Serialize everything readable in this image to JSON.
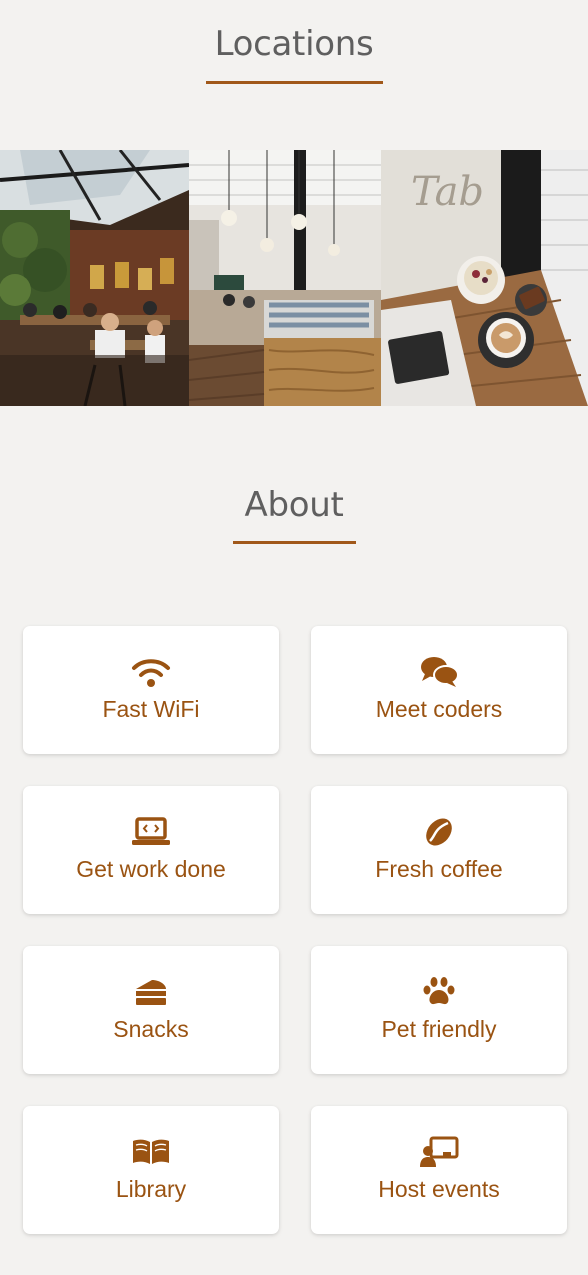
{
  "locations": {
    "title": "Locations",
    "photos": [
      {
        "alt": "Industrial cafe interior with skylights and people working"
      },
      {
        "alt": "Bright cafe counter with pendant lights"
      },
      {
        "alt": "Coffee, pastries and notebook on a wooden table by the window"
      }
    ]
  },
  "about": {
    "title": "About",
    "features": [
      {
        "label": "Fast WiFi",
        "icon": "wifi-icon"
      },
      {
        "label": "Meet coders",
        "icon": "chat-bubbles-icon"
      },
      {
        "label": "Get work done",
        "icon": "laptop-code-icon"
      },
      {
        "label": "Fresh coffee",
        "icon": "coffee-bean-icon"
      },
      {
        "label": "Snacks",
        "icon": "cake-slice-icon"
      },
      {
        "label": "Pet friendly",
        "icon": "paw-icon"
      },
      {
        "label": "Library",
        "icon": "book-open-icon"
      },
      {
        "label": "Host events",
        "icon": "presenter-icon"
      }
    ]
  },
  "colors": {
    "accent": "#a0581a",
    "text_accent": "#9a5312",
    "heading": "#5f5f5f",
    "background": "#f3f2f0",
    "card": "#ffffff"
  }
}
